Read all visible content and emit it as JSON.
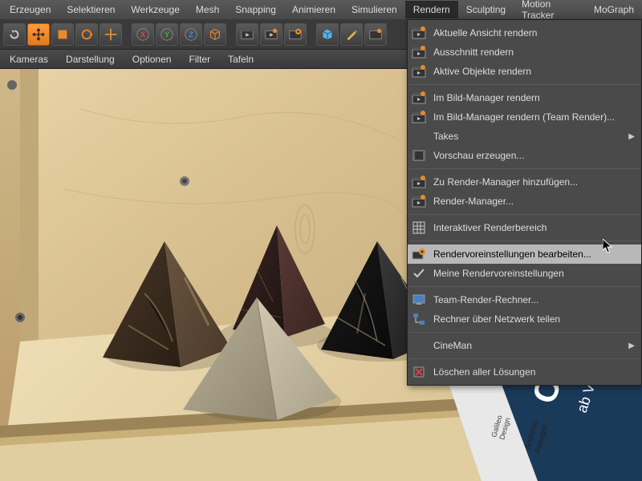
{
  "menubar": {
    "items": [
      "Erzeugen",
      "Selektieren",
      "Werkzeuge",
      "Mesh",
      "Snapping",
      "Animieren",
      "Simulieren",
      "Rendern",
      "Sculpting",
      "Motion Tracker",
      "MoGraph"
    ],
    "active": "Rendern"
  },
  "subbar": {
    "items": [
      "Kameras",
      "Darstellung",
      "Optionen",
      "Filter",
      "Tafeln"
    ]
  },
  "render_menu": {
    "groups": [
      [
        {
          "icon": "clap",
          "label": "Aktuelle Ansicht rendern"
        },
        {
          "icon": "clap",
          "label": "Ausschnitt rendern"
        },
        {
          "icon": "clap",
          "label": "Aktive Objekte rendern"
        }
      ],
      [
        {
          "icon": "clap",
          "label": "Im Bild-Manager rendern"
        },
        {
          "icon": "clap",
          "label": "Im Bild-Manager rendern (Team Render)..."
        },
        {
          "icon": "none",
          "label": "Takes",
          "submenu": true
        },
        {
          "icon": "film",
          "label": "Vorschau erzeugen..."
        }
      ],
      [
        {
          "icon": "clap",
          "label": "Zu Render-Manager hinzufügen..."
        },
        {
          "icon": "clap",
          "label": "Render-Manager..."
        }
      ],
      [
        {
          "icon": "grid",
          "label": "Interaktiver Renderbereich"
        }
      ],
      [
        {
          "icon": "gear",
          "label": "Rendervoreinstellungen bearbeiten...",
          "highlight": true
        },
        {
          "icon": "check",
          "label": "Meine Rendervoreinstellungen"
        }
      ],
      [
        {
          "icon": "mon",
          "label": "Team-Render-Rechner..."
        },
        {
          "icon": "net",
          "label": "Rechner über Netzwerk teilen"
        }
      ],
      [
        {
          "icon": "none",
          "label": "CineMan",
          "submenu": true
        }
      ],
      [
        {
          "icon": "del",
          "label": "Löschen aller Lösungen"
        }
      ]
    ]
  }
}
